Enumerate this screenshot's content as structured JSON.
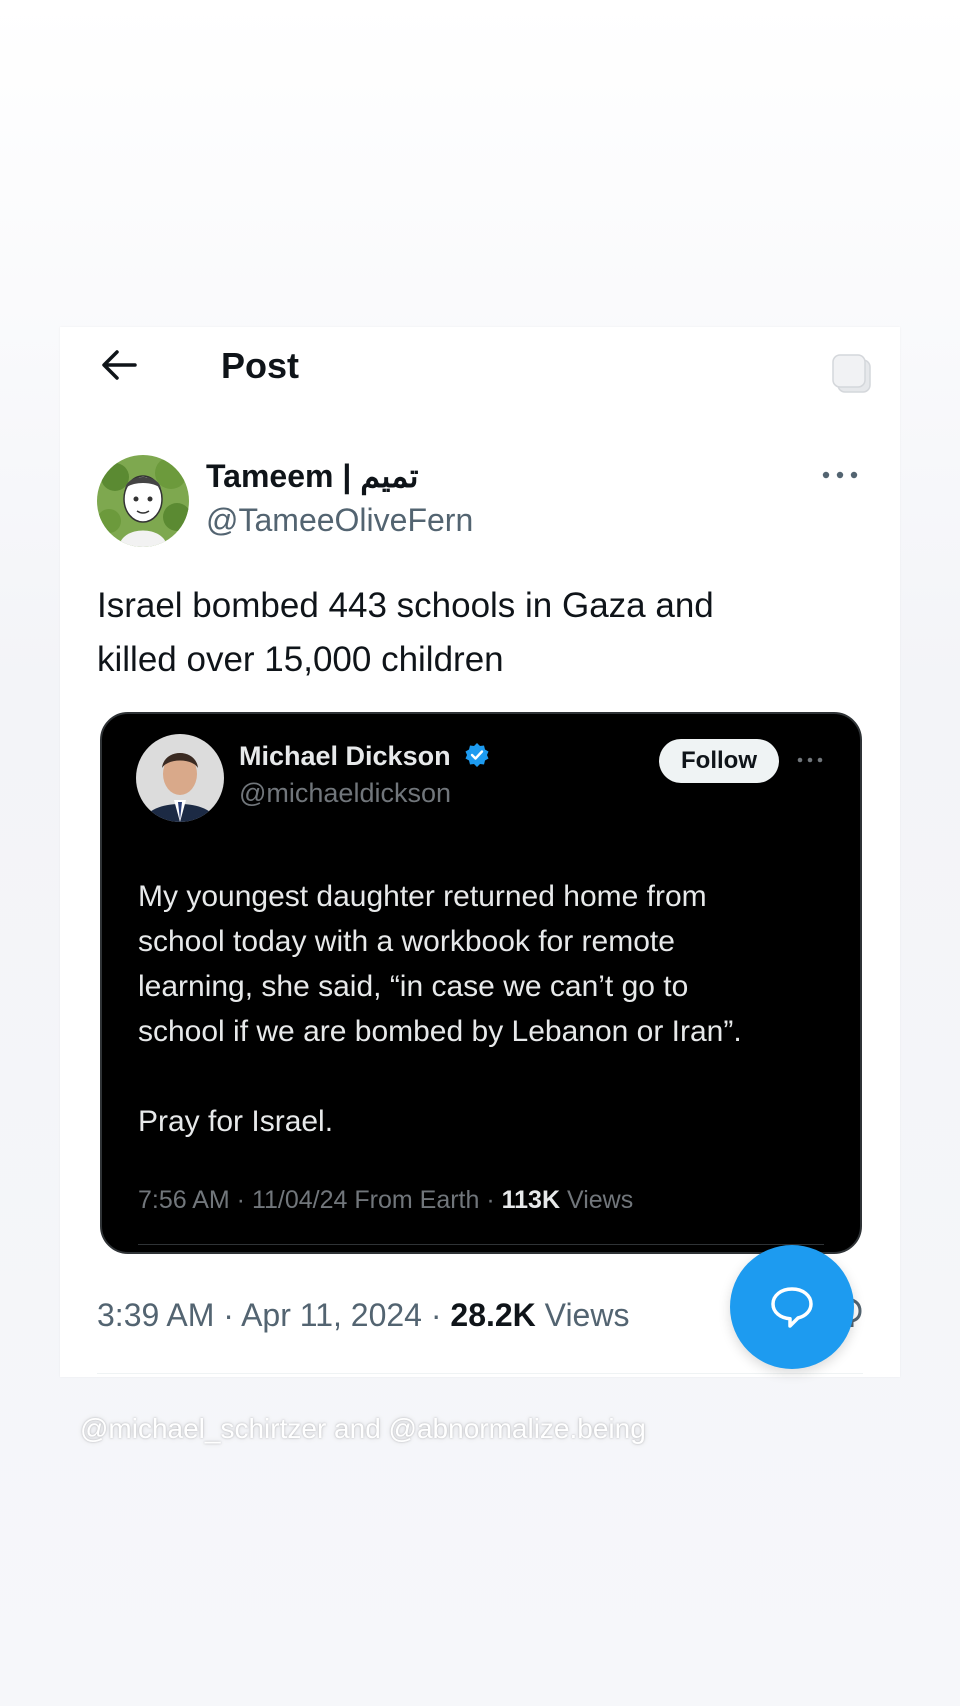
{
  "header": {
    "title": "Post",
    "back_icon": "arrow-left-icon",
    "copy_icon": "stack-copy-icon"
  },
  "post": {
    "author_name": "Tameem | تميم",
    "author_handle": "@TameeOliveFern",
    "text_line1": "Israel bombed 443 schools in Gaza and",
    "text_line2": "killed over 15,000 children",
    "time": "3:39 AM",
    "date": "Apr 11, 2024",
    "views_count": "28.2K",
    "views_label": "Views"
  },
  "quoted": {
    "name": "Michael Dickson",
    "handle": "@michaeldickson",
    "follow_label": "Follow",
    "body_lines": [
      "My youngest daughter returned home from",
      "school today with a workbook for remote",
      "learning, she said, “in case we can’t go to",
      "school if we are bombed by Lebanon or Iran”."
    ],
    "closing": "Pray for Israel.",
    "time": "7:56 AM",
    "date": "11/04/24",
    "source": "From Earth",
    "views_count": "113K",
    "views_label": "Views"
  },
  "credit": "@michael_schirtzer and @abnormalize.being",
  "colors": {
    "accent": "#1d9bf0",
    "text": "#0f1419",
    "muted": "#536471",
    "quote_bg": "#000000"
  }
}
